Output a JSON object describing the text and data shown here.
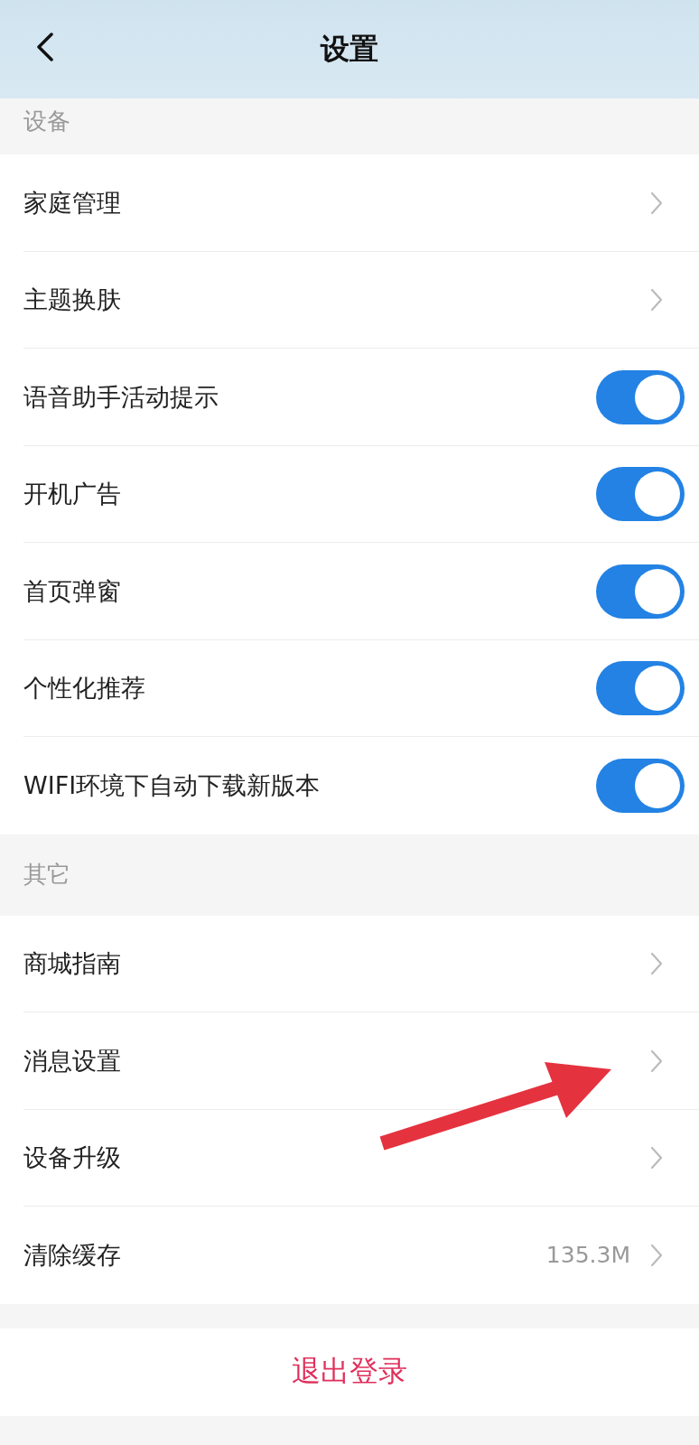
{
  "header": {
    "title": "设置"
  },
  "sections": [
    {
      "title": "设备",
      "items": [
        {
          "label": "家庭管理",
          "kind": "link"
        },
        {
          "label": "主题换肤",
          "kind": "link"
        },
        {
          "label": "语音助手活动提示",
          "kind": "toggle",
          "on": true
        },
        {
          "label": "开机广告",
          "kind": "toggle",
          "on": true
        },
        {
          "label": "首页弹窗",
          "kind": "toggle",
          "on": true
        },
        {
          "label": "个性化推荐",
          "kind": "toggle",
          "on": true
        },
        {
          "label": "WIFI环境下自动下载新版本",
          "kind": "toggle",
          "on": true
        }
      ]
    },
    {
      "title": "其它",
      "items": [
        {
          "label": "商城指南",
          "kind": "link"
        },
        {
          "label": "消息设置",
          "kind": "link"
        },
        {
          "label": "设备升级",
          "kind": "link"
        },
        {
          "label": "清除缓存",
          "kind": "link",
          "value": "135.3M"
        }
      ]
    }
  ],
  "logout": {
    "label": "退出登录"
  }
}
